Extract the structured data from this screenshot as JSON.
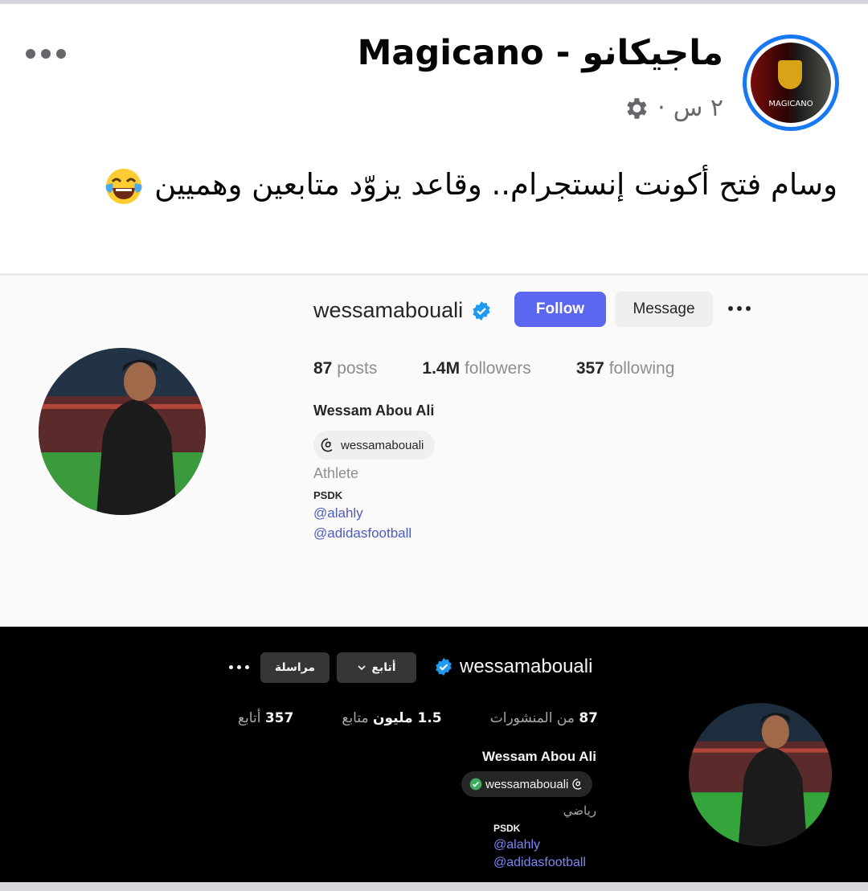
{
  "post": {
    "page_name": "ماجيكانو - Magicano",
    "time": "٢ س",
    "separator": "·",
    "text": "وسام فتح أكونت إنستجرام.. وقاعد يزوّد متابعين وهميين",
    "emoji": "laughing-tears-emoji",
    "avatar_text": "MAGICANO",
    "accent": "#1877f2"
  },
  "ig_light": {
    "username": "wessamabouali",
    "follow_label": "Follow",
    "message_label": "Message",
    "stats": [
      {
        "value": "87",
        "label": "posts"
      },
      {
        "value": "1.4M",
        "label": "followers"
      },
      {
        "value": "357",
        "label": "following"
      }
    ],
    "full_name": "Wessam Abou Ali",
    "threads_handle": "wessamabouali",
    "category": "Athlete",
    "bio_line": "PSDK",
    "link_1": "@alahly",
    "link_2": "@adidasfootball",
    "follow_color": "#5b67f0"
  },
  "ig_dark": {
    "username": "wessamabouali",
    "follow_label": "أتابع",
    "message_label": "مراسلة",
    "stats": [
      {
        "value": "87",
        "label": "من المنشورات"
      },
      {
        "value": "1.5 مليون",
        "label": "متابع"
      },
      {
        "value": "357",
        "label": "أتابع"
      }
    ],
    "full_name": "Wessam Abou Ali",
    "threads_handle": "wessamabouali",
    "category": "رياضي",
    "bio_line": "PSDK",
    "link_1": "@alahly",
    "link_2": "@adidasfootball"
  }
}
